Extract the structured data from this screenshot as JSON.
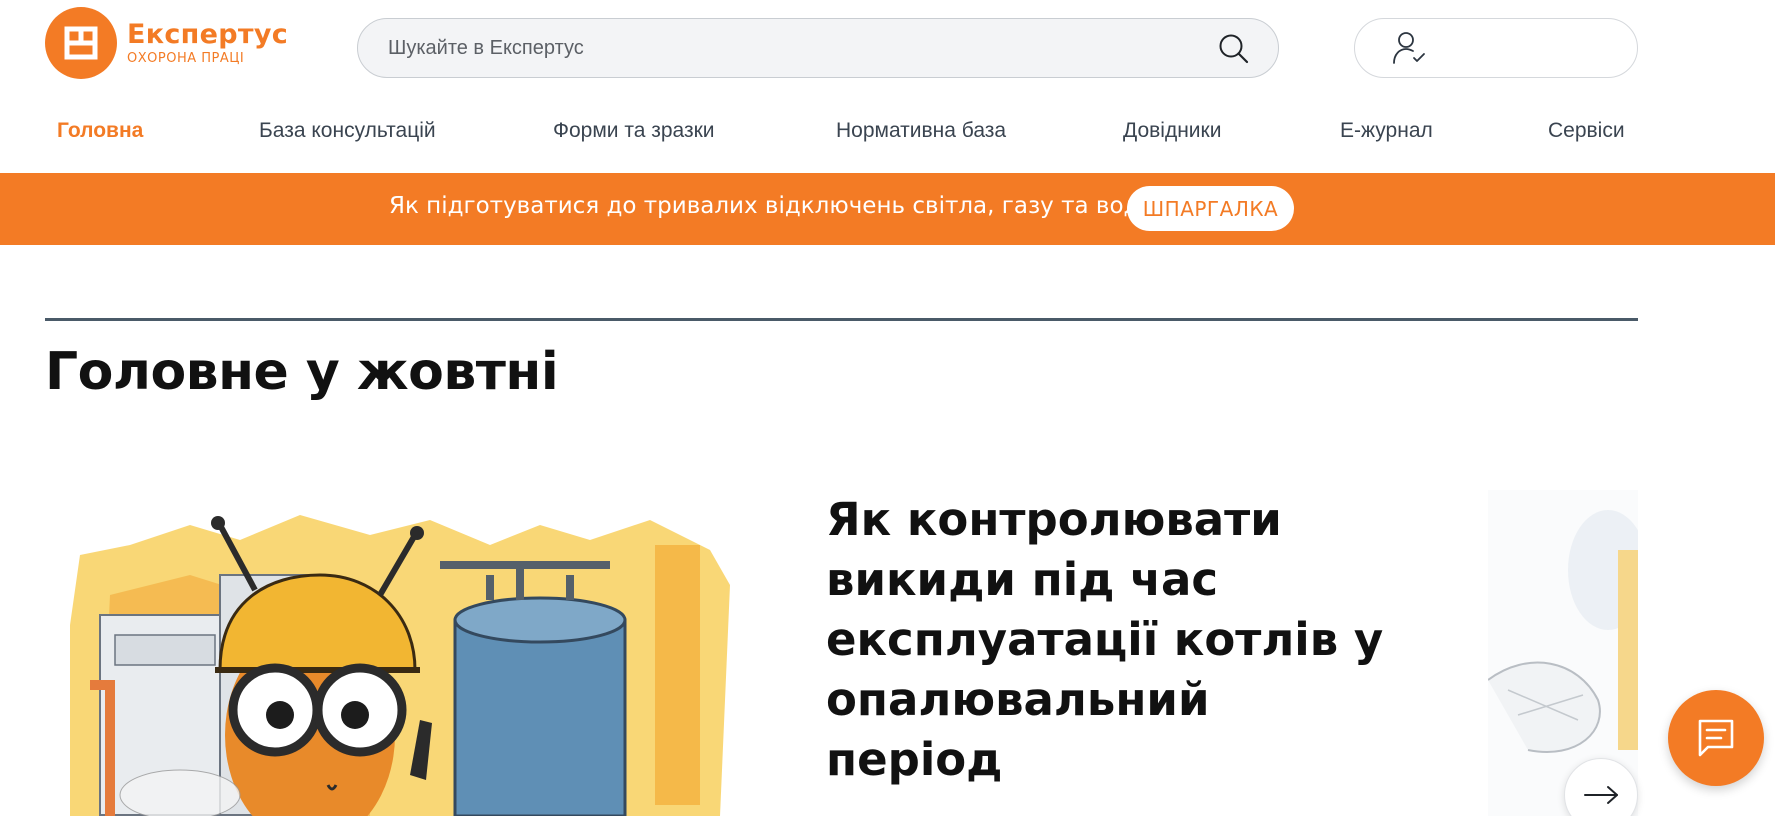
{
  "brand": {
    "name": "Експертус",
    "subtitle": "ОХОРОНА ПРАЦІ",
    "accent_color": "#f37b25"
  },
  "search": {
    "placeholder": "Шукайте в Експертус",
    "value": "",
    "icon": "search-icon"
  },
  "account": {
    "icon": "user-check-icon"
  },
  "nav": {
    "items": [
      {
        "label": "Головна",
        "active": true
      },
      {
        "label": "База консультацій",
        "active": false
      },
      {
        "label": "Форми та зразки",
        "active": false
      },
      {
        "label": "Нормативна база",
        "active": false
      },
      {
        "label": "Довідники",
        "active": false
      },
      {
        "label": "Е-журнал",
        "active": false
      },
      {
        "label": "Сервіси",
        "active": false
      }
    ]
  },
  "banner": {
    "text": "Як підготуватися до тривалих відключень світла, газу та води",
    "button_label": "ШПАРГАЛКА",
    "background": "#f37b25"
  },
  "section": {
    "title": "Головне у жовтні"
  },
  "slide": {
    "title": "Як контролювати викиди під час експлуатації котлів у опалювальний період",
    "image": "bee-worker-illustration",
    "next_icon": "arrow-right-icon"
  },
  "chat": {
    "icon": "chat-icon"
  }
}
